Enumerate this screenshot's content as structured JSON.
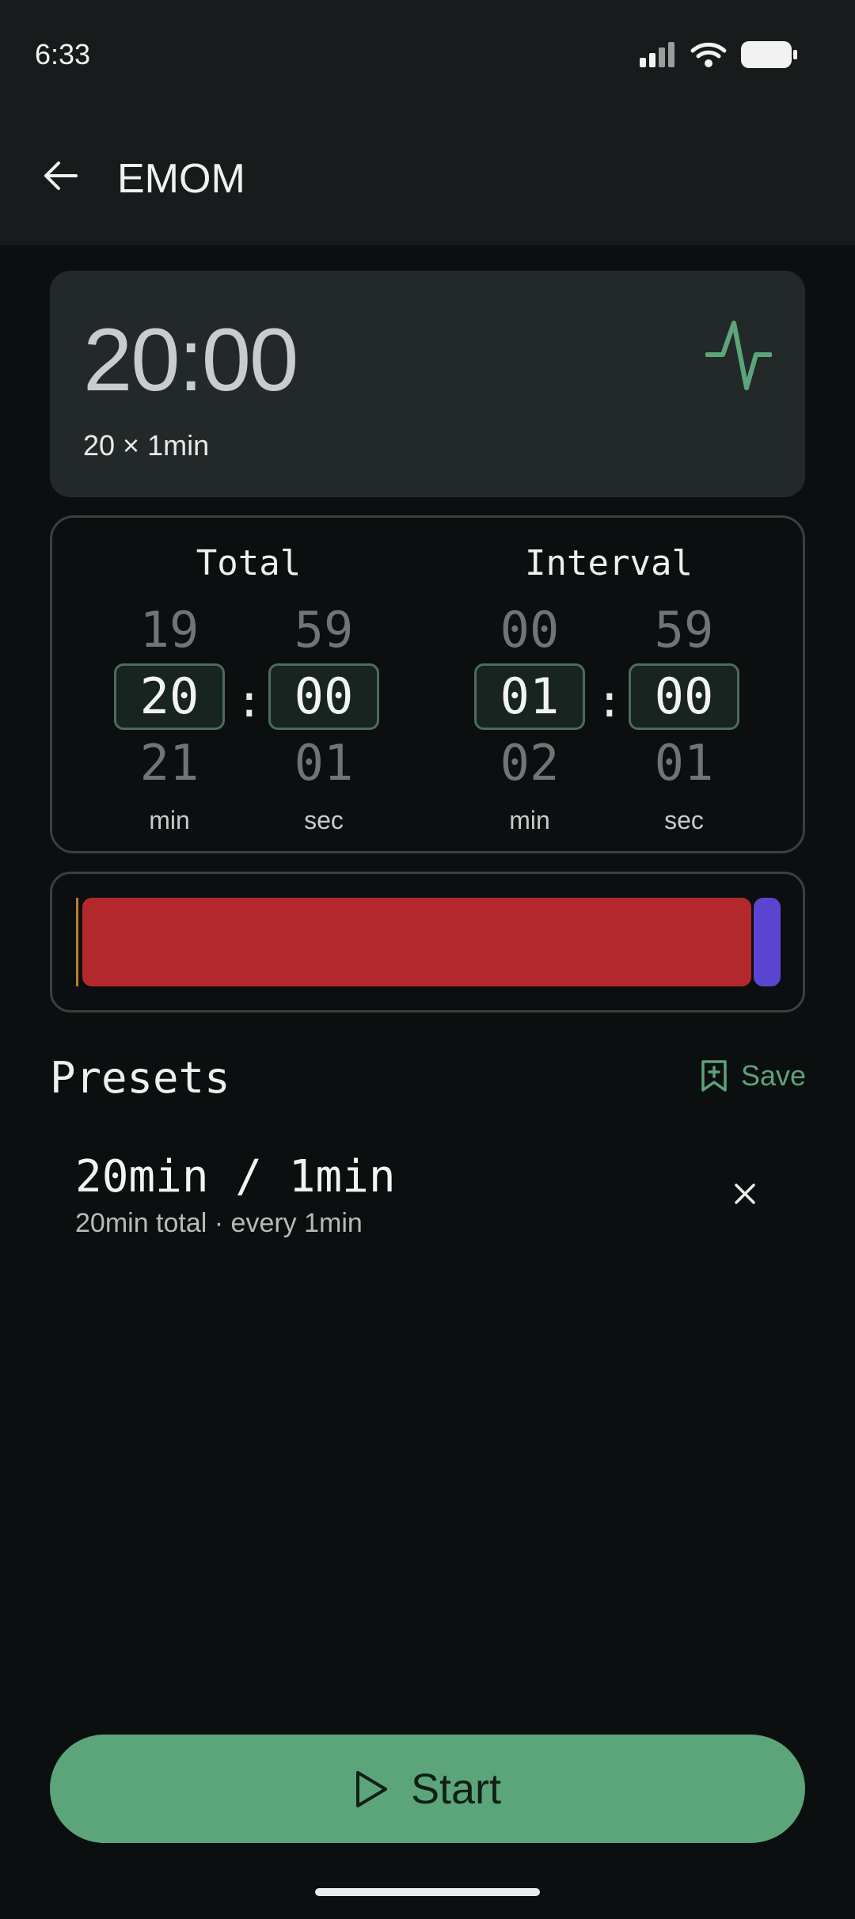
{
  "status_bar": {
    "time": "6:33"
  },
  "app_bar": {
    "title": "EMOM",
    "back_icon": "arrow-left-icon"
  },
  "summary": {
    "time": "20:00",
    "subtitle": "20 × 1min",
    "icon": "pulse-icon",
    "accent": "#5ca57b"
  },
  "picker": {
    "total": {
      "title": "Total",
      "minutes": {
        "prev": "19",
        "current": "20",
        "next": "21",
        "unit": "min"
      },
      "seconds": {
        "prev": "59",
        "current": "00",
        "next": "01",
        "unit": "sec"
      }
    },
    "interval": {
      "title": "Interval",
      "minutes": {
        "prev": "00",
        "current": "01",
        "next": "02",
        "unit": "min"
      },
      "seconds": {
        "prev": "59",
        "current": "00",
        "next": "01",
        "unit": "sec"
      }
    },
    "separator": ":"
  },
  "timeline": {
    "work_color": "#b3282d",
    "rest_color": "#5b45d0",
    "marker_color": "#c07a2a"
  },
  "presets": {
    "title": "Presets",
    "save_label": "Save",
    "items": [
      {
        "name": "20min / 1min",
        "description": "20min total · every 1min"
      }
    ]
  },
  "start_button": {
    "label": "Start",
    "color": "#5ca57b"
  }
}
